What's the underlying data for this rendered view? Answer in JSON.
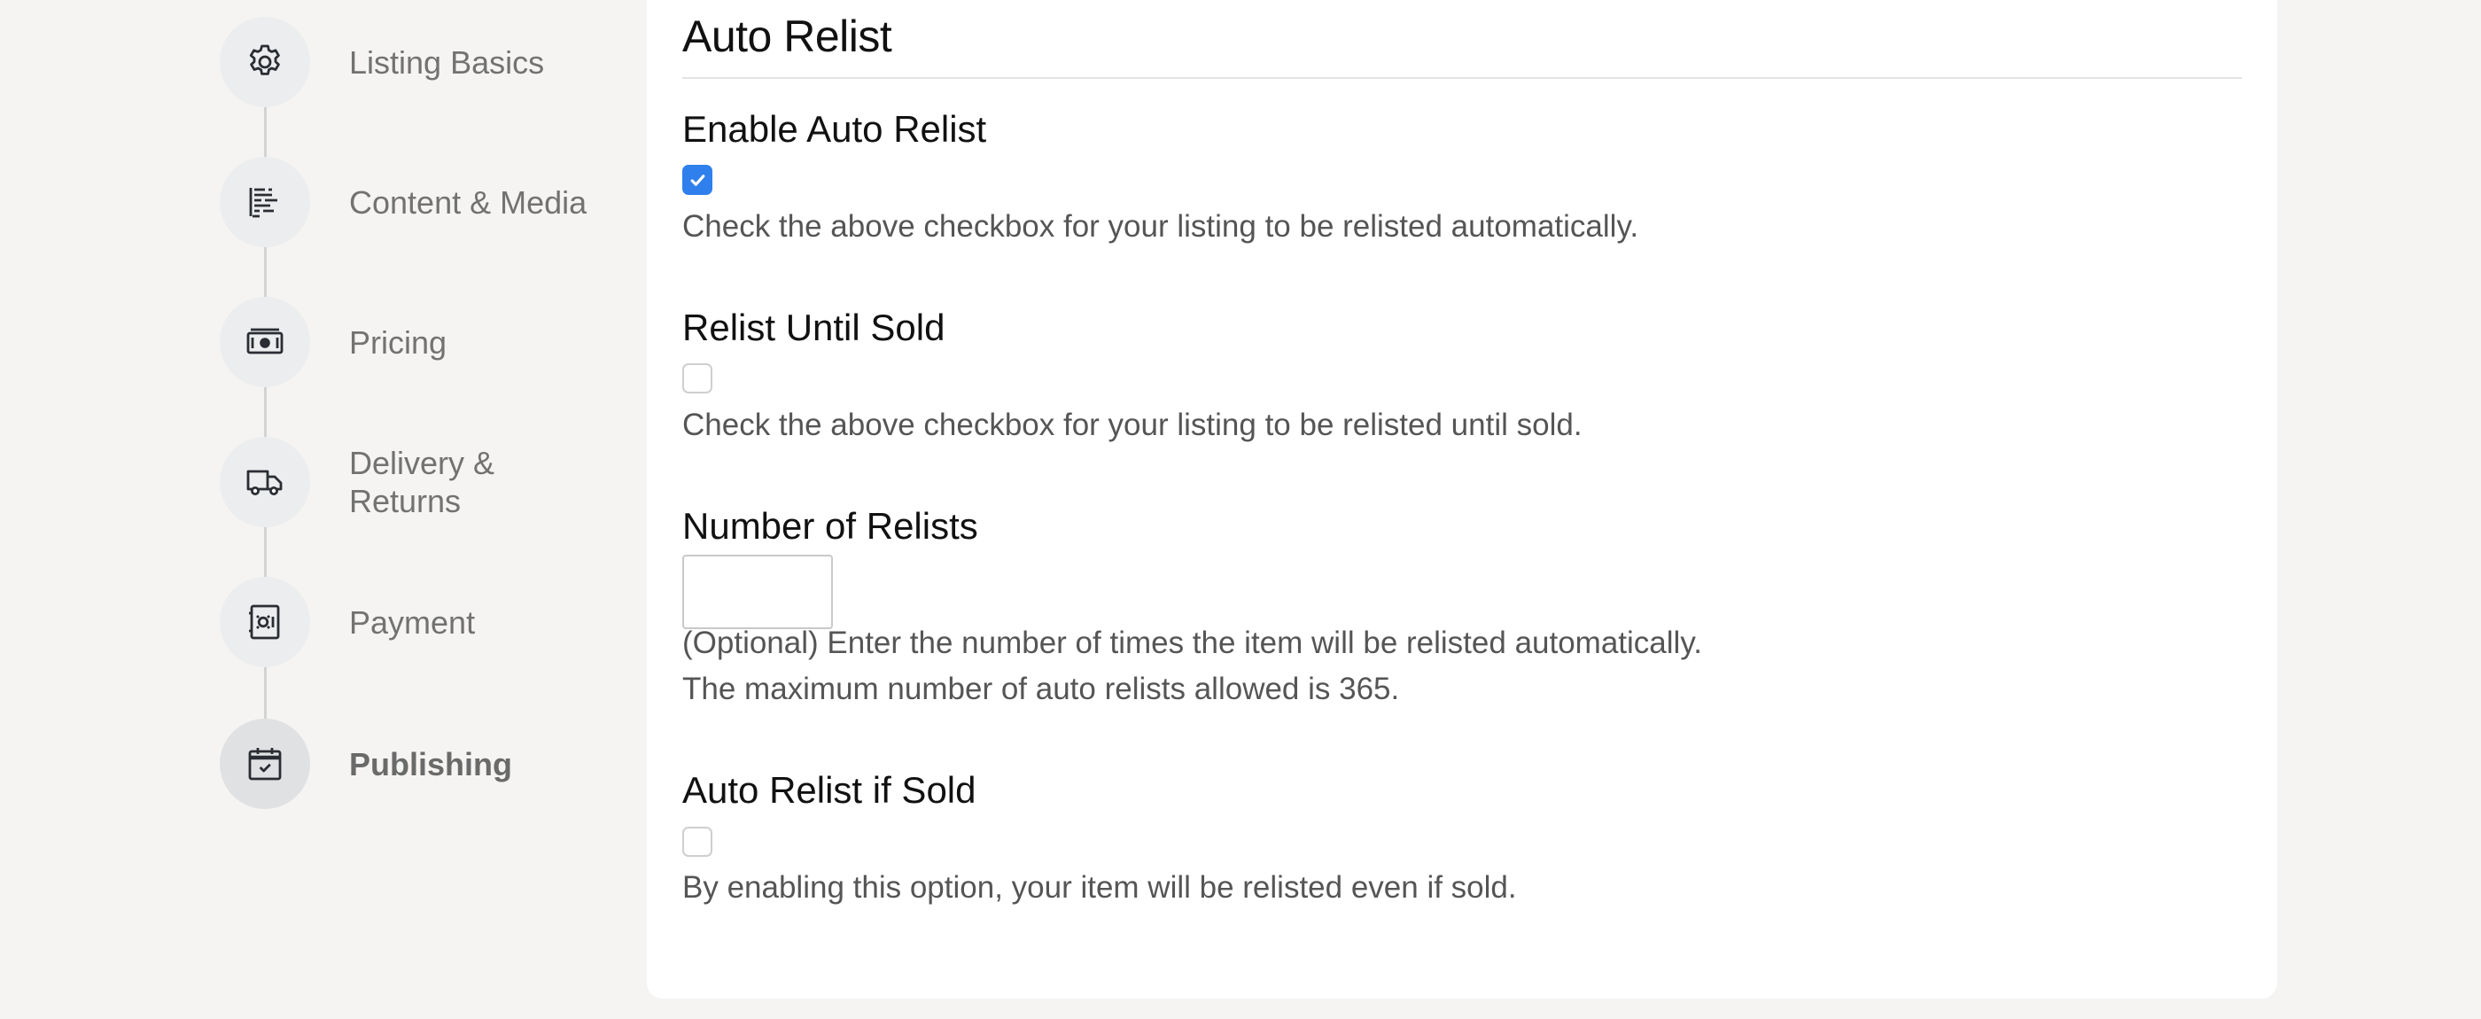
{
  "steps": [
    {
      "label": "Listing Basics",
      "icon": "gear-icon"
    },
    {
      "label": "Content & Media",
      "icon": "text-lines-icon"
    },
    {
      "label": "Pricing",
      "icon": "cash-icon"
    },
    {
      "label": "Delivery & Returns",
      "icon": "truck-icon"
    },
    {
      "label": "Payment",
      "icon": "safe-icon"
    },
    {
      "label": "Publishing",
      "icon": "calendar-check-icon",
      "active": true
    }
  ],
  "section": {
    "title": "Auto Relist",
    "enable_auto_relist": {
      "label": "Enable Auto Relist",
      "checked": true,
      "help": "Check the above checkbox for your listing to be relisted automatically."
    },
    "relist_until_sold": {
      "label": "Relist Until Sold",
      "checked": false,
      "help": "Check the above checkbox for your listing to be relisted until sold."
    },
    "number_of_relists": {
      "label": "Number of Relists",
      "value": "",
      "help_line1": "(Optional) Enter the number of times the item will be relisted automatically.",
      "help_line2": "The maximum number of auto relists allowed is 365."
    },
    "auto_relist_if_sold": {
      "label": "Auto Relist if Sold",
      "checked": false,
      "help": "By enabling this option, your item will be relisted even if sold."
    }
  },
  "colors": {
    "accent": "#2f80ed",
    "page_bg": "#f5f4f2",
    "card_bg": "#ffffff"
  }
}
